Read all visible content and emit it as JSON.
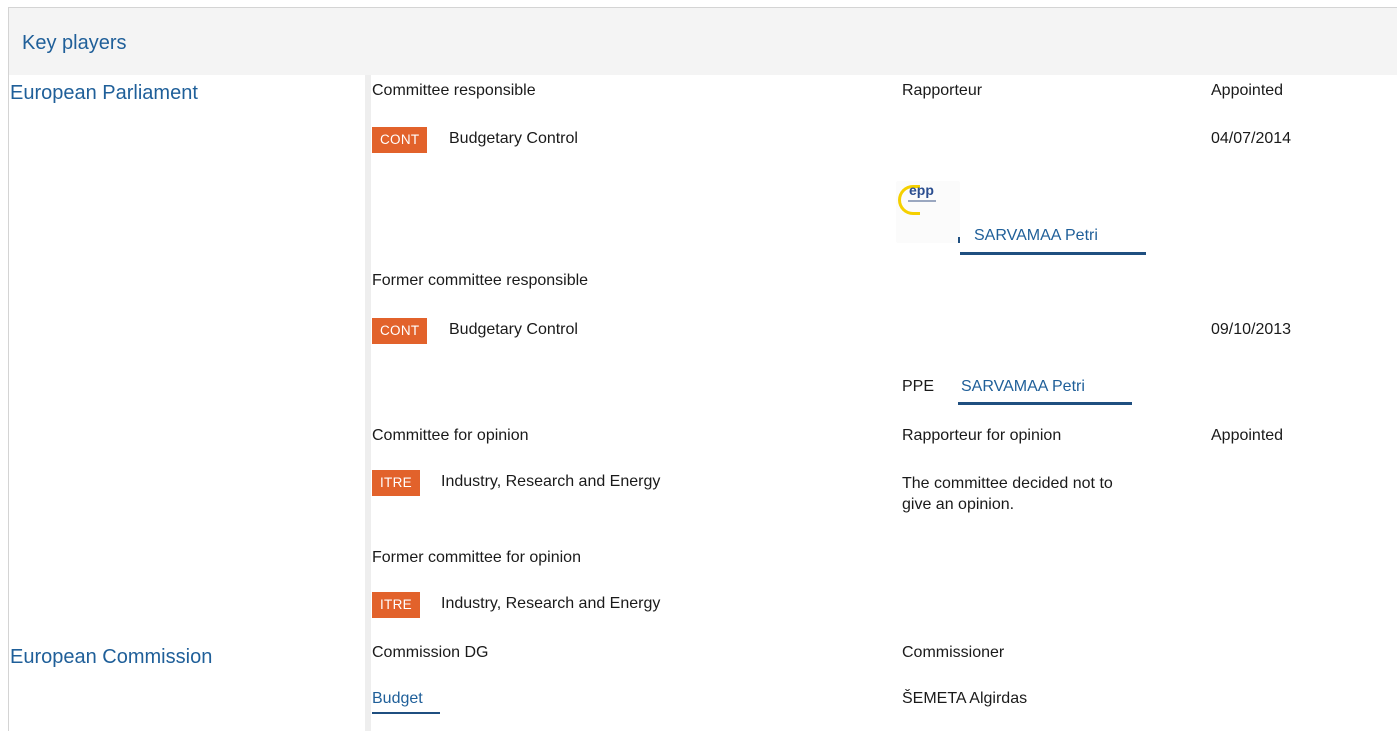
{
  "header": {
    "title": "Key players"
  },
  "parliament": {
    "title": "European Parliament",
    "committee_responsible_label": "Committee responsible",
    "rapporteur_label": "Rapporteur",
    "appointed_label": "Appointed",
    "cont_tag": "CONT",
    "cont_name": "Budgetary Control",
    "cont_date": "04/07/2014",
    "rapporteur_name": "SARVAMAA Petri",
    "former_committee_label": "Former committee responsible",
    "former_cont_tag": "CONT",
    "former_cont_name": "Budgetary Control",
    "former_cont_date": "09/10/2013",
    "former_rapporteur_group": "PPE",
    "former_rapporteur_name": "SARVAMAA Petri",
    "committee_opinion_label": "Committee for opinion",
    "rapporteur_opinion_label": "Rapporteur for opinion",
    "appointed_opinion_label": "Appointed",
    "itre_tag": "ITRE",
    "itre_name": "Industry, Research and Energy",
    "opinion_note": "The committee decided not to give an opinion.",
    "former_opinion_label": "Former committee for opinion",
    "former_itre_tag": "ITRE",
    "former_itre_name": "Industry, Research and Energy"
  },
  "commission": {
    "title": "European Commission",
    "dg_label": "Commission DG",
    "commissioner_label": "Commissioner",
    "dg_name": "Budget",
    "commissioner_name": "ŠEMETA Algirdas"
  },
  "logo": {
    "text": "epp",
    "icon": "epp-logo-icon"
  },
  "colors": {
    "accent": "#1f5f99",
    "tag": "#e2622b",
    "header_bg": "#f4f4f4"
  }
}
